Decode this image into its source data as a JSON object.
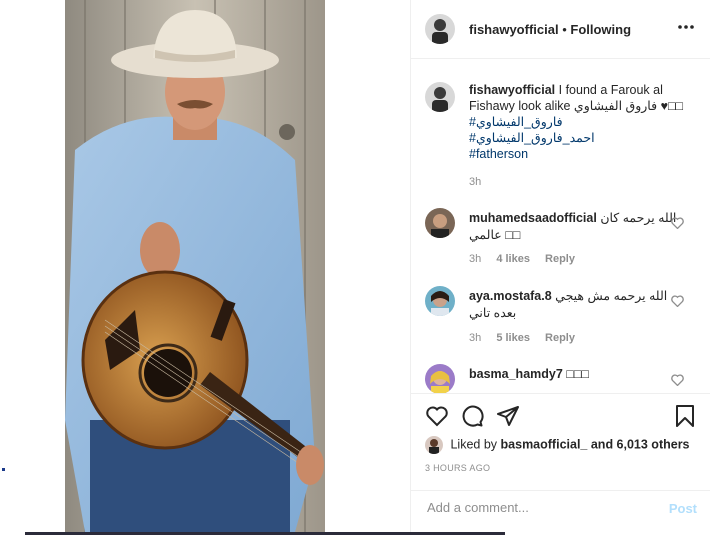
{
  "header": {
    "username": "fishawyofficial",
    "separator": "•",
    "follow_status": "Following",
    "more_icon": "more-horizontal-icon"
  },
  "caption": {
    "username": "fishawyofficial",
    "text_line1": "I found a Farouk al",
    "text_line2": "Fishawy look alike فاروق الفيشاوي ♥□□",
    "hashtags": [
      "#فاروق_الفيشاوي",
      "#احمد_فاروق_الفيشاوي",
      "#fatherson"
    ],
    "time": "3h"
  },
  "comments": [
    {
      "username": "muhamedsaadofficial",
      "text": "الله يرحمه كان عالمي □□",
      "time": "3h",
      "likes": "4 likes",
      "reply": "Reply"
    },
    {
      "username": "aya.mostafa.8",
      "text": "الله يرحمه مش هيجي بعده تاني",
      "time": "3h",
      "likes": "5 likes",
      "reply": "Reply"
    },
    {
      "username": "basma_hamdy7",
      "text": "□□□"
    }
  ],
  "actions": {
    "like_icon": "heart-icon",
    "comment_icon": "comment-icon",
    "share_icon": "send-icon",
    "save_icon": "bookmark-icon"
  },
  "likes": {
    "prefix": "Liked by",
    "user": "basmaofficial_",
    "suffix": "and 6,013 others"
  },
  "posted": "3 HOURS AGO",
  "add_comment": {
    "placeholder": "Add a comment...",
    "post_label": "Post"
  },
  "colors": {
    "link": "#00376b",
    "muted": "#8e8e8e",
    "post_button": "#b2dffc",
    "border": "#efefef"
  }
}
